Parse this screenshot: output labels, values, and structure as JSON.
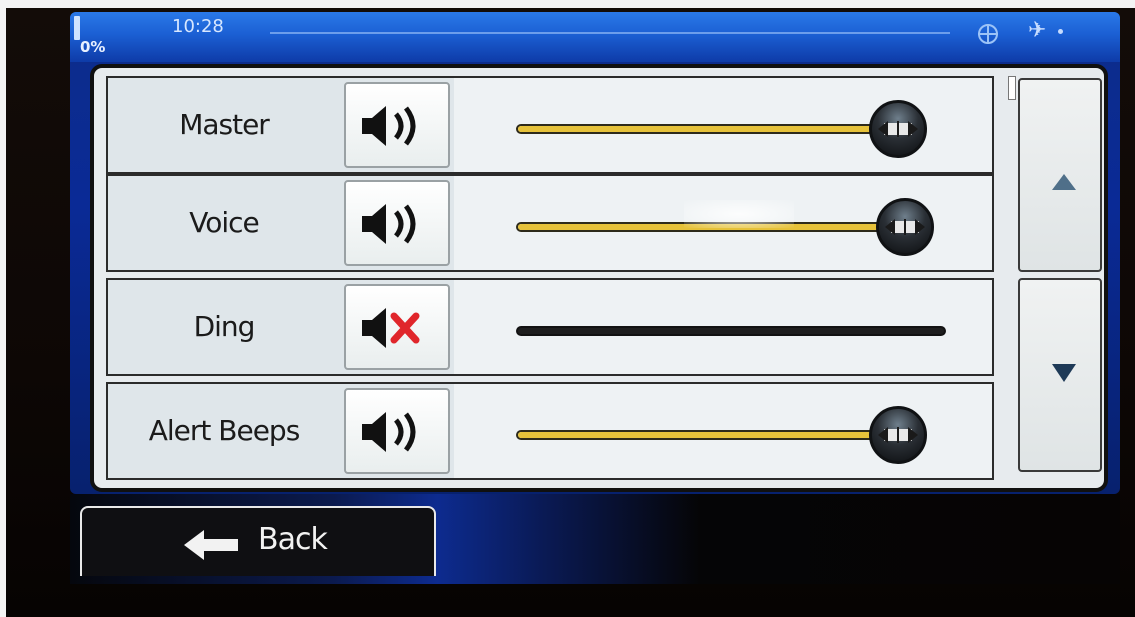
{
  "status_bar": {
    "battery_percent": "0%",
    "time": "10:28",
    "title": "",
    "icons": [
      "battery-icon",
      "globe-icon",
      "satellite-icon"
    ]
  },
  "volume_settings": {
    "rows": [
      {
        "label": "Master",
        "muted": false,
        "icon": "speaker-on-icon",
        "level": 0.95
      },
      {
        "label": "Voice",
        "muted": false,
        "icon": "speaker-on-icon",
        "level": 0.97
      },
      {
        "label": "Ding",
        "muted": true,
        "icon": "speaker-muted-icon",
        "level": 0.0
      },
      {
        "label": "Alert Beeps",
        "muted": false,
        "icon": "speaker-on-icon",
        "level": 0.95
      }
    ]
  },
  "scroll": {
    "up_icon": "triangle-up-icon",
    "down_icon": "triangle-down-icon"
  },
  "footer": {
    "back_label": "Back",
    "back_icon": "arrow-left-icon"
  },
  "colors": {
    "slider_fill": "#e6c23a",
    "mute_x": "#e0262b",
    "status_bar_blue": "#1b5fd3"
  }
}
